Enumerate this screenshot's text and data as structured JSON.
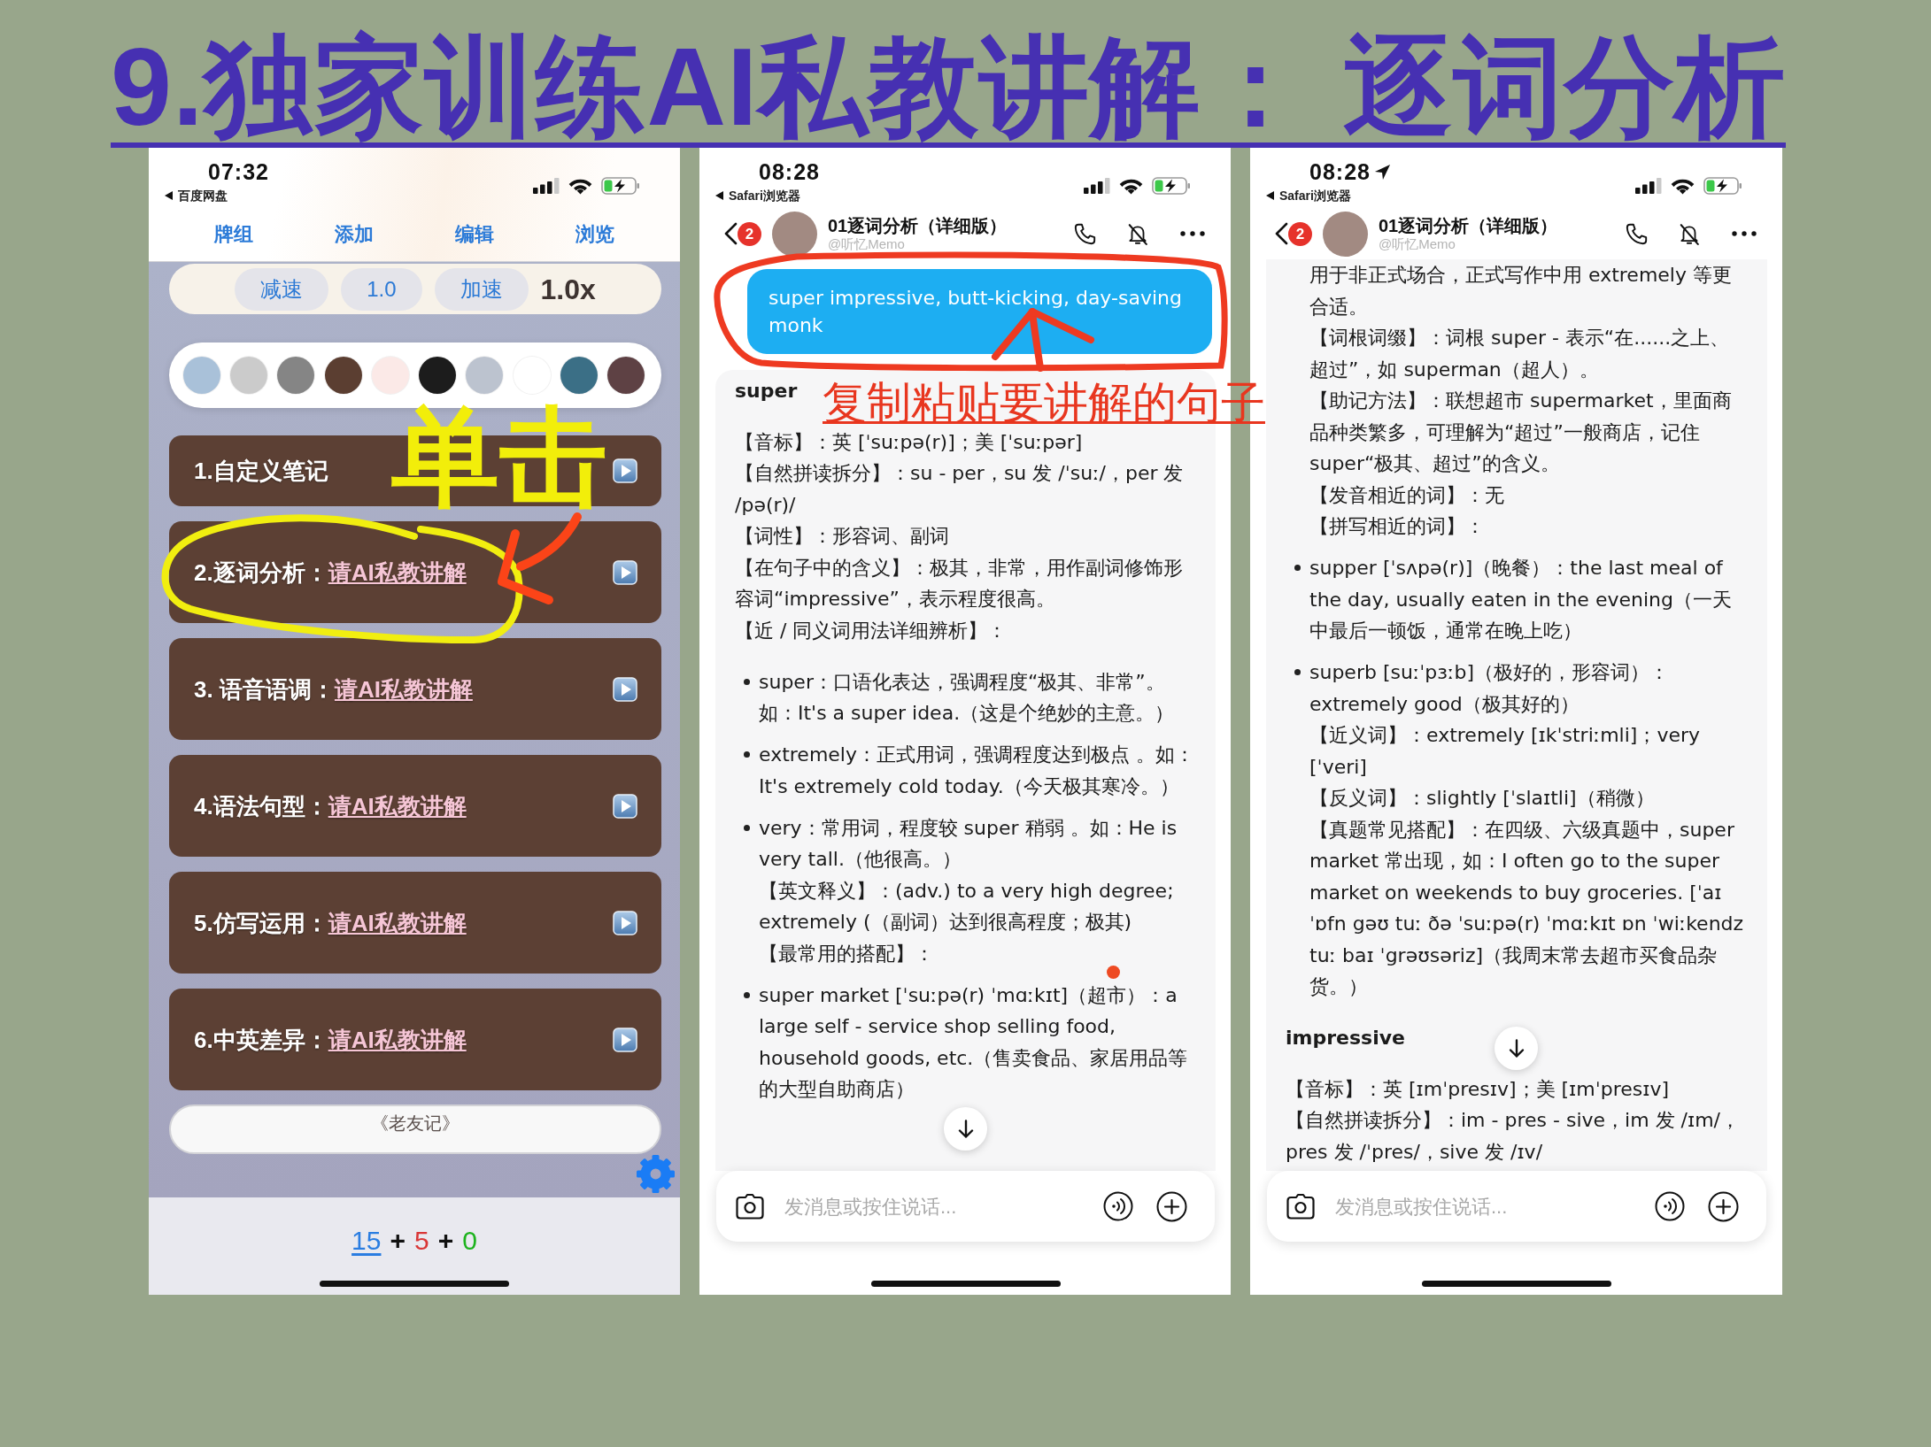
{
  "title": "9.独家训练AI私教讲解： 逐词分析",
  "app_screen": {
    "status_bar": {
      "time": "07:32",
      "back_label": "百度网盘"
    },
    "nav_links": [
      "牌组",
      "添加",
      "编辑",
      "浏览"
    ],
    "speed": {
      "buttons": [
        "减速",
        "1.0",
        "加速"
      ],
      "reading": "1.0x"
    },
    "swatches": [
      {
        "color": "#a9c1d9"
      },
      {
        "color": "#cbcbcb"
      },
      {
        "color": "#858585"
      },
      {
        "color": "#5b3e31"
      },
      {
        "color": "#fbe9e7"
      },
      {
        "color": "#1c1c1c"
      },
      {
        "color": "#bcc3cf"
      },
      {
        "color": "#ffffff"
      },
      {
        "color": "#3b6f86"
      },
      {
        "color": "#5e4144"
      }
    ],
    "items": [
      {
        "kind": "note",
        "label": "1.自定义笔记"
      },
      {
        "kind": "tutor",
        "label": "2.逐词分析：",
        "link": "请AI私教讲解"
      },
      {
        "kind": "tutor",
        "label": "3. 语音语调：",
        "link": "请AI私教讲解"
      },
      {
        "kind": "tutor",
        "label": "4.语法句型：",
        "link": "请AI私教讲解"
      },
      {
        "kind": "tutor",
        "label": "5.仿写运用：",
        "link": "请AI私教讲解"
      },
      {
        "kind": "tutor",
        "label": "6.中英差异：",
        "link": "请AI私教讲解"
      }
    ],
    "callout": "单击",
    "footer_button": "《老友记》",
    "counts": [
      {
        "kind": "link",
        "text": "15",
        "color": "#2a7de1"
      },
      {
        "kind": "plain",
        "text": "+",
        "color": "#111111"
      },
      {
        "kind": "plain",
        "text": "5",
        "color": "#d93636"
      },
      {
        "kind": "plain",
        "text": "+",
        "color": "#111111"
      },
      {
        "kind": "plain",
        "text": "0",
        "color": "#1db31d"
      }
    ]
  },
  "chat_screens": [
    {
      "status_bar": {
        "time": "08:28",
        "back_label": "Safari浏览器"
      },
      "header": {
        "badge": "2",
        "title": "01逐词分析（详细版）",
        "subtitle": "@听忆Memo"
      },
      "message": "super impressive, butt-kicking, day-saving monk",
      "callout": "复制粘贴要讲解的句子",
      "reply": [
        {
          "kind": "heading",
          "text": "super"
        },
        {
          "kind": "para",
          "text": "【音标】：英 [ˈsuːpə(r)]；美 [ˈsuːpər]"
        },
        {
          "kind": "para",
          "text": "【自然拼读拆分】：su - per，su 发 /ˈsuː/，per 发 /pə(r)/"
        },
        {
          "kind": "para",
          "text": "【词性】：形容词、副词"
        },
        {
          "kind": "para",
          "text": "【在句子中的含义】：极其，非常，用作副词修饰形容词“impressive”，表示程度很高。"
        },
        {
          "kind": "para",
          "text": "【近 / 同义词用法详细辨析】："
        },
        {
          "kind": "bullet",
          "text": "super：口语化表达，强调程度“极其、非常”。如：It's a super idea.（这是个绝妙的主意。）"
        },
        {
          "kind": "bullet",
          "text": "extremely：正式用词，强调程度达到极点 。如：It's extremely cold today.（今天极其寒冷。）"
        },
        {
          "kind": "bullet",
          "text": "very：常用词，程度较 super 稍弱 。如：He is very tall.（他很高。）"
        },
        {
          "kind": "note",
          "text": "【英文释义】：(adv.) to a very high degree; extremely (（副词）达到很高程度；极其)"
        },
        {
          "kind": "note",
          "text": "【最常用的搭配】："
        },
        {
          "kind": "bullet",
          "text": "super market [ˈsuːpə(r) ˈmɑːkɪt]（超市）：a large self - service shop selling food, household goods, etc.（售卖食品、家居用品等的大型自助商店）"
        }
      ],
      "input_placeholder": "发消息或按住说话..."
    },
    {
      "status_bar": {
        "time": "08:28",
        "location_arrow": true,
        "back_label": "Safari浏览器"
      },
      "header": {
        "badge": "2",
        "title": "01逐词分析（详细版）",
        "subtitle": "@听忆Memo"
      },
      "reply": [
        {
          "kind": "note",
          "text": "用于非正式场合，正式写作中用 extremely 等更合适。"
        },
        {
          "kind": "note",
          "text": "【词根词缀】：词根 super - 表示“在......之上、超过”，如 superman（超人）。"
        },
        {
          "kind": "note",
          "text": "【助记方法】：联想超市 supermarket，里面商品种类繁多，可理解为“超过”一般商店，记住 super“极其、超过”的含义。"
        },
        {
          "kind": "note",
          "text": "【发音相近的词】：无"
        },
        {
          "kind": "note",
          "text": "【拼写相近的词】："
        },
        {
          "kind": "bullet",
          "text": "supper [ˈsʌpə(r)]（晚餐）：the last meal of the day, usually eaten in the evening（一天中最后一顿饭，通常在晚上吃）"
        },
        {
          "kind": "bullet",
          "text": "superb [suːˈpɜːb]（极好的，形容词）：extremely good（极其好的）"
        },
        {
          "kind": "note",
          "text": "【近义词】：extremely [ɪkˈstriːmli]；very [ˈveri]"
        },
        {
          "kind": "note",
          "text": "【反义词】：slightly [ˈslaɪtli]（稍微）"
        },
        {
          "kind": "note",
          "text": "【真题常见搭配】：在四级、六级真题中，super market 常出现，如：I often go to the super market on weekends to buy groceries. [ˈaɪ ˈɒfn gəʊ tuː ðə ˈsuːpə(r) ˈmɑːkɪt ɒn ˈwiːkendz tuː baɪ ˈgrəʊsəriz]（我周末常去超市买食品杂货。）"
        },
        {
          "kind": "heading",
          "text": "impressive"
        },
        {
          "kind": "para",
          "text": "【音标】：英 [ɪmˈpresɪv]；美 [ɪmˈpresɪv]"
        },
        {
          "kind": "para",
          "text": "【自然拼读拆分】：im - pres - sive，im 发 /ɪm/，pres 发 /ˈpres/，sive 发 /ɪv/"
        }
      ],
      "input_placeholder": "发消息或按住说话..."
    }
  ]
}
